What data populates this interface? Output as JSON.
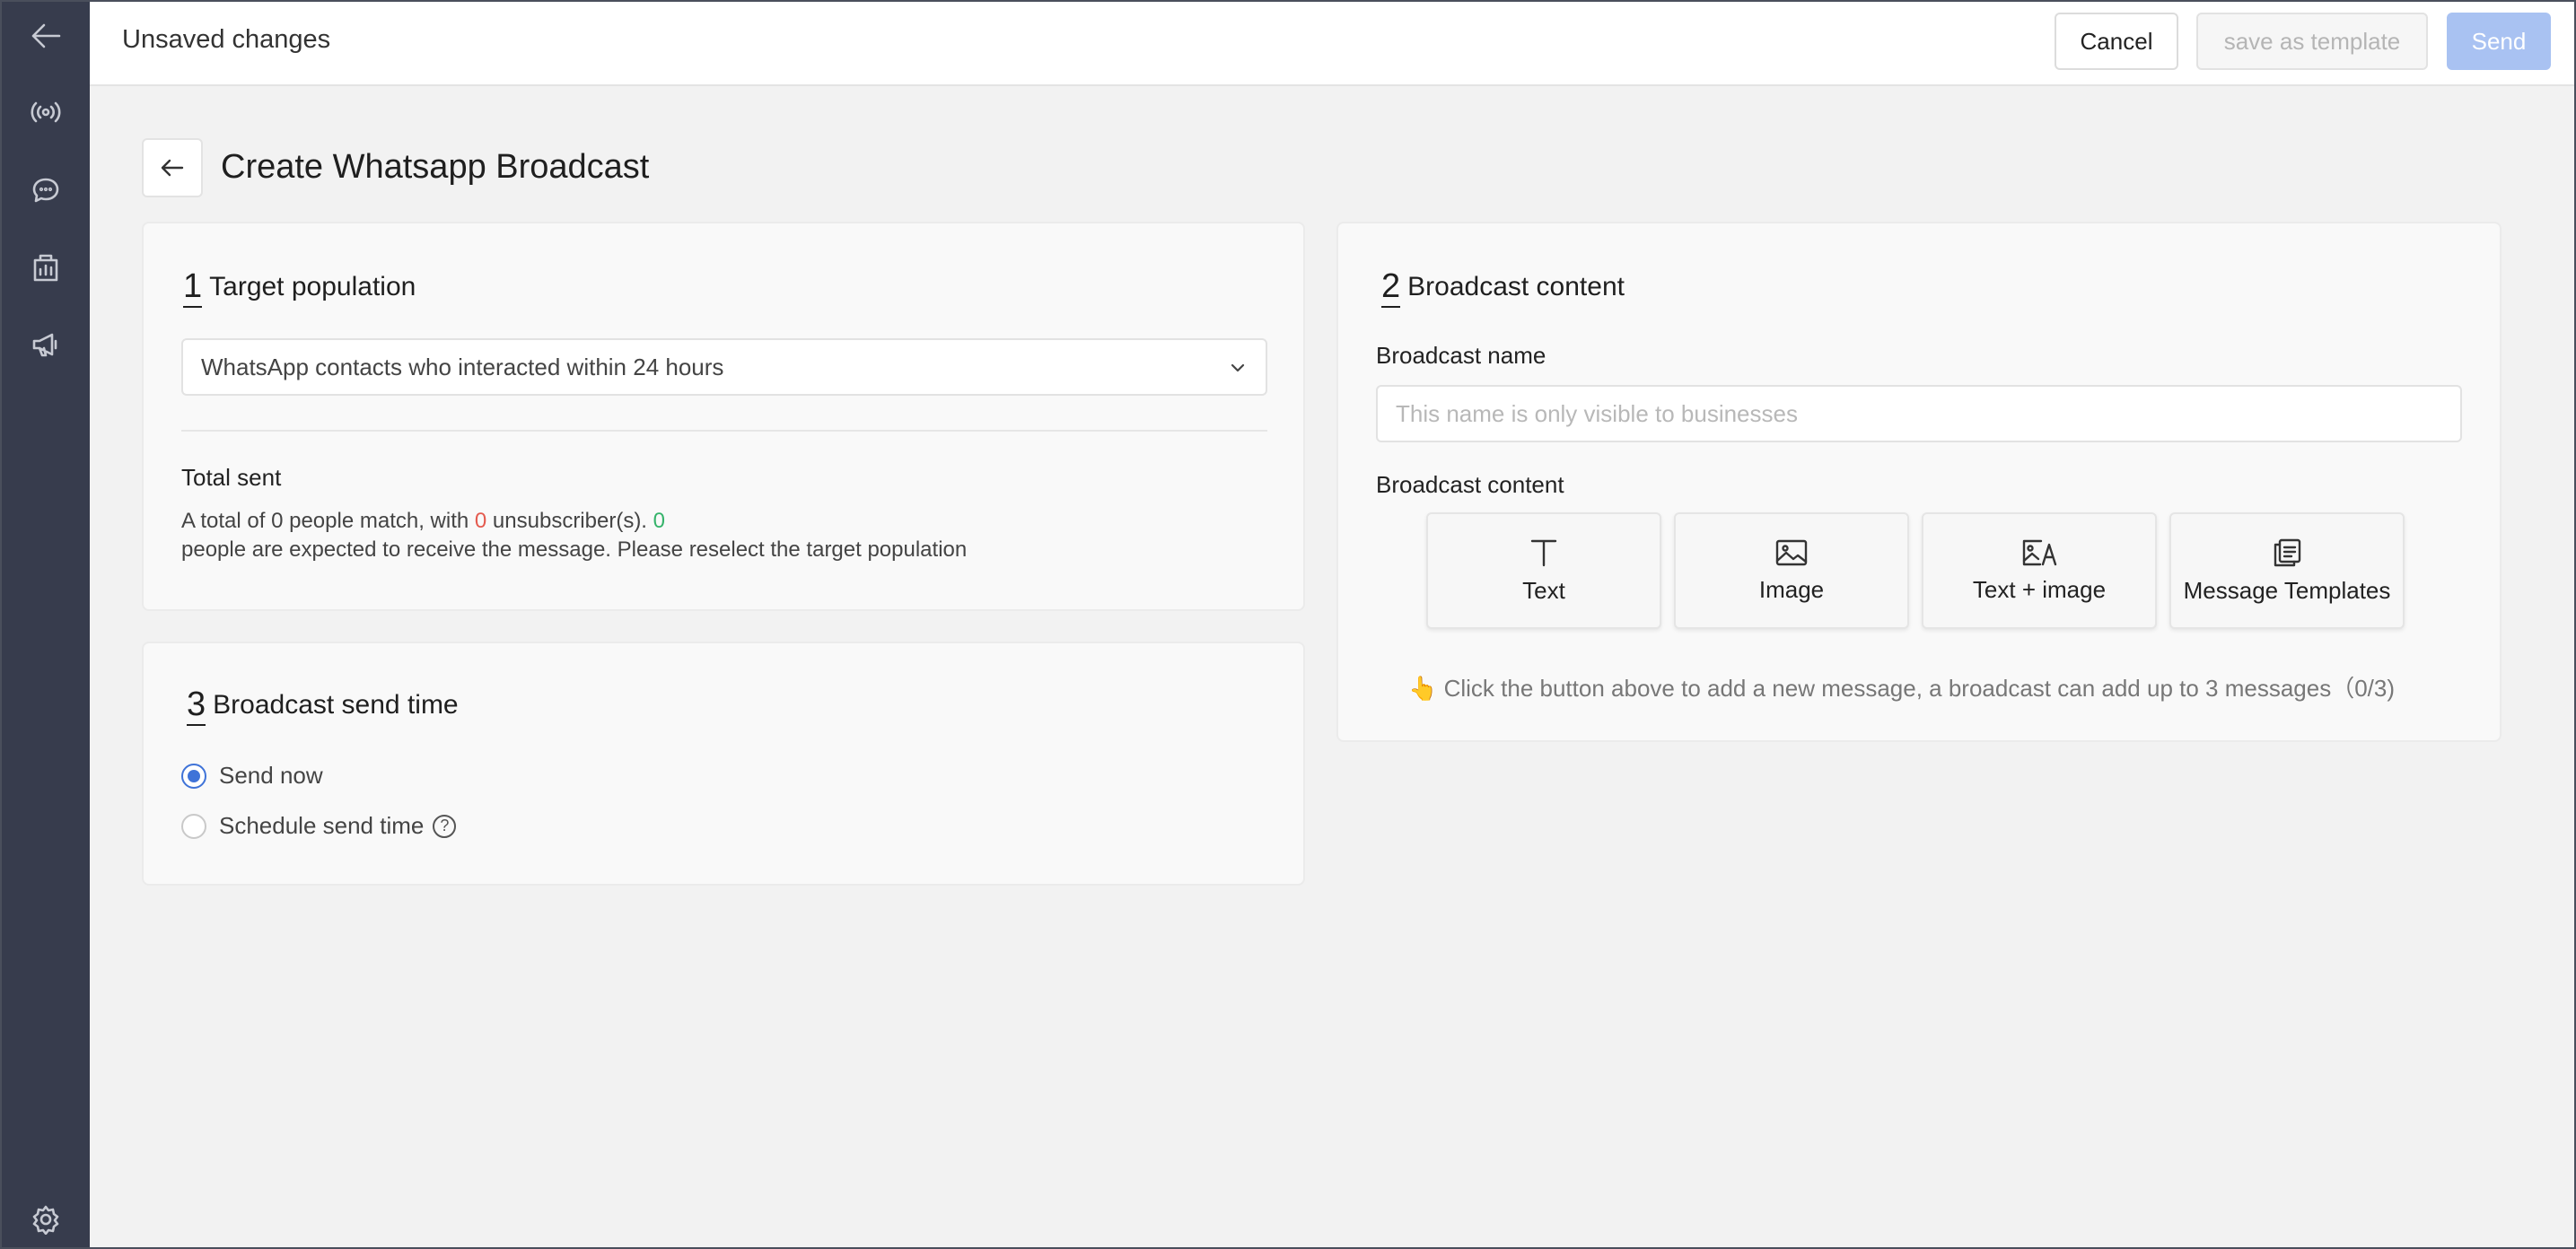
{
  "topbar": {
    "title": "Unsaved changes",
    "cancel_label": "Cancel",
    "template_label": "save as template",
    "send_label": "Send"
  },
  "page": {
    "title": "Create Whatsapp Broadcast"
  },
  "target": {
    "number": "1",
    "heading": "Target population",
    "selected": "WhatsApp contacts who interacted within 24 hours",
    "total_label": "Total sent",
    "line1_prefix": "A total of",
    "match_count": "0",
    "line1_mid": "people match, with",
    "unsub_count": "0",
    "line1_suffix": "unsubscriber(s).",
    "expected_count": "0",
    "line2": "people are expected to receive the message. Please reselect the target population"
  },
  "send_time": {
    "number": "3",
    "heading": "Broadcast send time",
    "options": [
      {
        "label": "Send now",
        "selected": true
      },
      {
        "label": "Schedule send time",
        "selected": false
      }
    ],
    "help_icon": "question-circle-icon"
  },
  "content": {
    "number": "2",
    "heading": "Broadcast content",
    "name_label": "Broadcast name",
    "name_placeholder": "This name is only visible to businesses",
    "content_label": "Broadcast content",
    "tiles": [
      {
        "label": "Text",
        "icon": "text-icon"
      },
      {
        "label": "Image",
        "icon": "image-icon"
      },
      {
        "label": "Text + image",
        "icon": "text-image-icon"
      },
      {
        "label": "Message Templates",
        "icon": "template-icon"
      }
    ],
    "hint": "👆 Click the button above to add a new message, a broadcast can add up to 3 messages（0/3)"
  },
  "sidebar": {
    "icons": [
      "back-arrow-icon",
      "broadcast-icon",
      "chat-icon",
      "analytics-icon",
      "megaphone-icon",
      "settings-icon"
    ]
  },
  "colors": {
    "accent": "#3f73d8",
    "sidebar": "#373c4d",
    "send_disabled": "#a9c2f2",
    "warn": "#e45b4f",
    "ok": "#35b36a"
  }
}
